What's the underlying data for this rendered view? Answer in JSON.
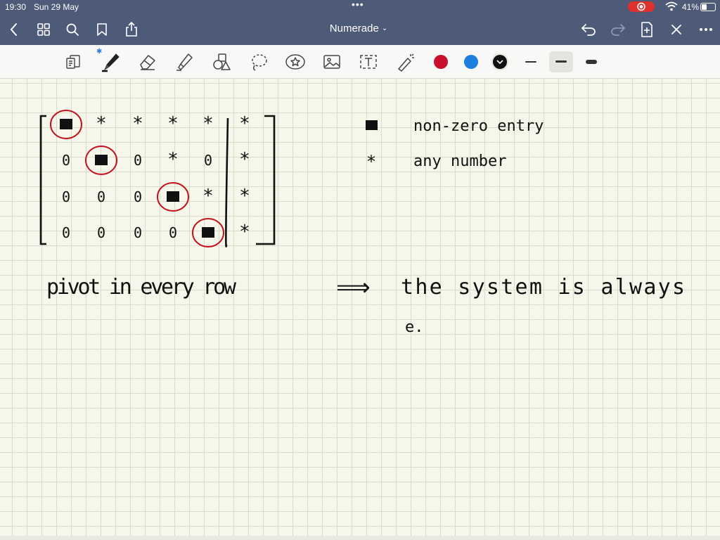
{
  "status_bar": {
    "time": "19:30",
    "date": "Sun 29 May",
    "dots": "•••",
    "battery_percent": "41%",
    "icons": [
      "screen-record-icon",
      "wifi-icon",
      "battery-icon"
    ]
  },
  "nav_bar": {
    "title": "Numerade",
    "title_caret": "⌄",
    "left_icons": [
      "back-chevron-icon",
      "grid-icon",
      "search-icon",
      "bookmark-icon",
      "share-icon"
    ],
    "right_icons": [
      "undo-icon",
      "redo-icon",
      "add-page-icon",
      "close-icon",
      "more-icon"
    ]
  },
  "toolbar": {
    "tools": [
      "view-mode-icon",
      "pen-icon",
      "eraser-icon",
      "highlighter-icon",
      "shapes-icon",
      "lasso-icon",
      "stickers-icon",
      "image-icon",
      "text-icon",
      "laser-pointer-icon"
    ],
    "bluetooth_mark": "✱",
    "colors": {
      "red": "#c8102e",
      "blue": "#1e7fe0",
      "black": "#111111"
    },
    "selected_color": "black",
    "stroke_widths": [
      "thin",
      "medium",
      "thick"
    ],
    "selected_stroke": "medium",
    "ink_accent": "#c0141d"
  },
  "note": {
    "matrix": {
      "rows": [
        [
          "■",
          "*",
          "*",
          "*",
          "*",
          "*"
        ],
        [
          "0",
          "■",
          "0",
          "*",
          "0",
          "*"
        ],
        [
          "0",
          "0",
          "0",
          "■",
          "*",
          "*"
        ],
        [
          "0",
          "0",
          "0",
          "0",
          "■",
          "*"
        ]
      ]
    },
    "legend": [
      {
        "symbol": "■",
        "label": "non-zero entry"
      },
      {
        "symbol": "*",
        "label": "any number"
      }
    ],
    "statement": {
      "left": "pivot in every row",
      "arrow": "⟹",
      "right": "the system is always",
      "continuation": "e."
    }
  }
}
